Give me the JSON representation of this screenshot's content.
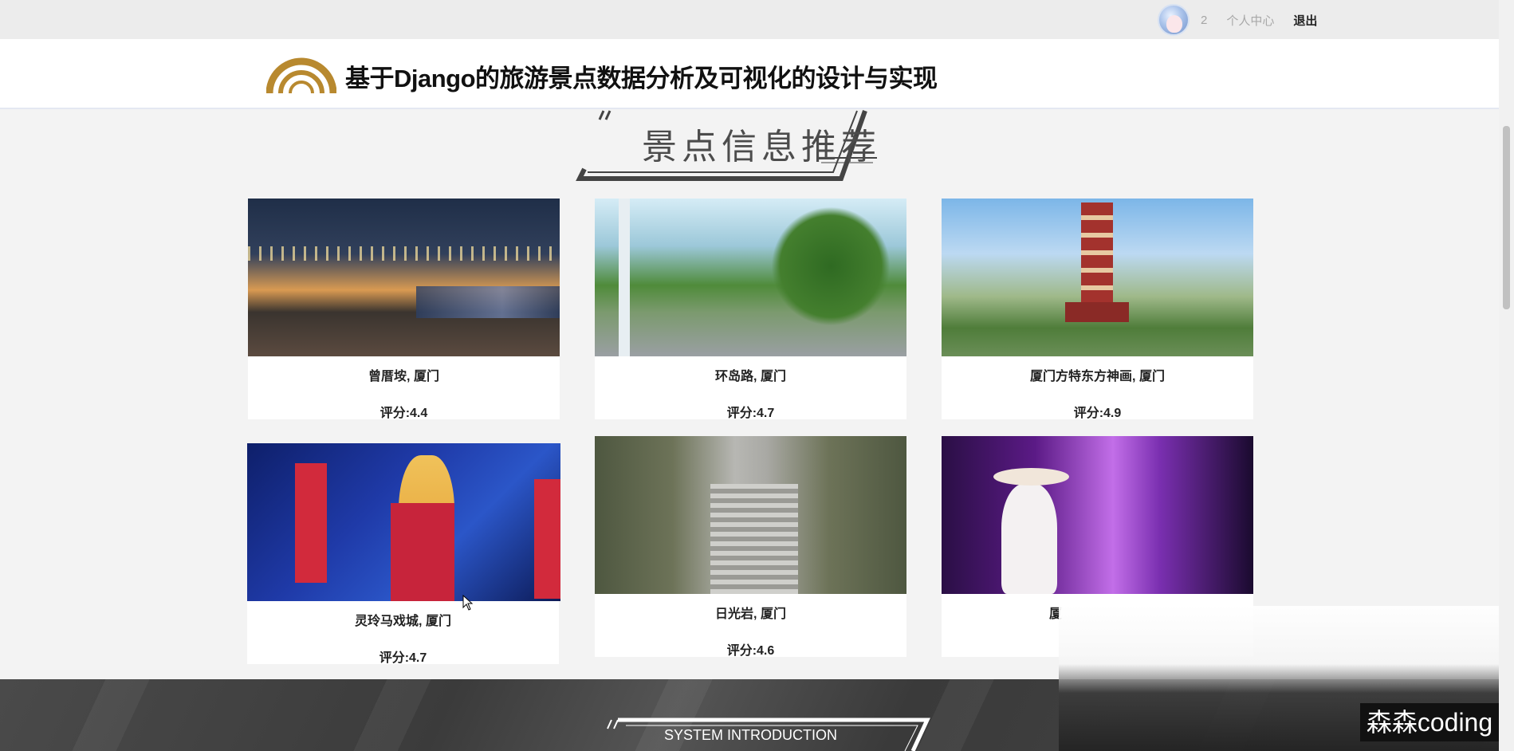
{
  "user_bar": {
    "avatar_icon": "user-avatar",
    "count": "2",
    "user_center_label": "个人中心",
    "logout_label": "退出"
  },
  "header": {
    "logo_icon": "rainbow-arc-logo",
    "title": "基于Django的旅游景点数据分析及可视化的设计与实现"
  },
  "section": {
    "heading": "景点信息推荐"
  },
  "attractions": [
    {
      "name": "曾厝垵, 厦门",
      "score": "评分:4.4"
    },
    {
      "name": "环岛路, 厦门",
      "score": "评分:4.7"
    },
    {
      "name": "厦门方特东方神画, 厦门",
      "score": "评分:4.9"
    },
    {
      "name": "灵玲马戏城, 厦门",
      "score": "评分:4.7"
    },
    {
      "name": "日光岩, 厦门",
      "score": "评分:4.6"
    },
    {
      "name": "厦",
      "score": ""
    }
  ],
  "footer": {
    "heading": "SYSTEM INTRODUCTION"
  },
  "watermark": "森森coding",
  "colors": {
    "logo_gold": "#b8892f",
    "page_bg": "#f3f3f3",
    "footer_bg": "#444444"
  }
}
